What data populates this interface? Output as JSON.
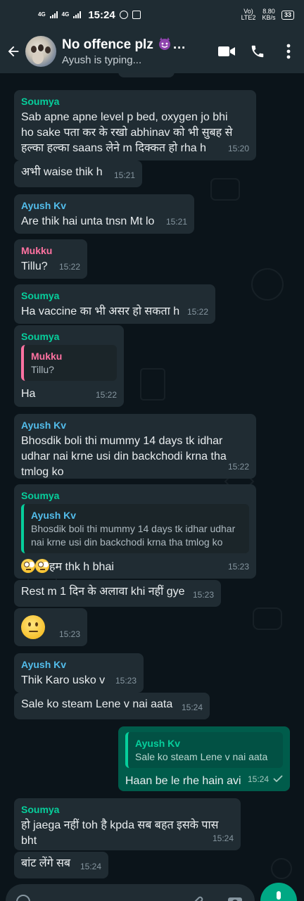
{
  "status_bar": {
    "net_left_1": "4G",
    "net_left_2": "4G",
    "time": "15:24",
    "volte": "Vo) LTE2",
    "speed": "8.80 KB/s",
    "battery": "33"
  },
  "header": {
    "title": "No offence plz",
    "subtitle": "Ayush is typing..."
  },
  "messages": [
    {
      "sender": "Soumya",
      "text": "Sab apne apne level p bed, oxygen jo bhi ho sake पता कर के रखो abhinav को भी सुबह से हल्का हल्का saans लेने m दिक्कत हो rha h",
      "time": "15:20"
    },
    {
      "sender": "",
      "text": "अभी waise thik h",
      "time": "15:21"
    },
    {
      "sender": "Ayush Kv",
      "text": "Are thik hai unta tnsn Mt lo",
      "time": "15:21"
    },
    {
      "sender": "Mukku",
      "text": "Tillu?",
      "time": "15:22"
    },
    {
      "sender": "Soumya",
      "text": "Ha vaccine का भी असर हो सकता h",
      "time": "15:22"
    },
    {
      "sender": "Soumya",
      "quote_name": "Mukku",
      "quote_text": "Tillu?",
      "text": "Ha",
      "time": "15:22"
    },
    {
      "sender": "Ayush Kv",
      "text": "Bhosdik boli thi mummy 14 days tk idhar udhar nai krne usi din backchodi krna tha tmlog ko",
      "time": "15:22"
    },
    {
      "sender": "Soumya",
      "quote_name": "Ayush Kv",
      "quote_text": "Bhosdik boli thi mummy 14 days tk idhar udhar nai krne usi din backchodi krna tha tmlog ko",
      "text": "हम thk h bhai",
      "time": "15:23"
    },
    {
      "sender": "",
      "text": "Rest m 1 दिन के अलावा khi नहीं gye",
      "time": "15:23"
    },
    {
      "sender": "",
      "text": "",
      "time": "15:23"
    },
    {
      "sender": "Ayush Kv",
      "text": "Thik Karo usko v",
      "time": "15:23"
    },
    {
      "sender": "",
      "text": "Sale ko steam Lene v nai aata",
      "time": "15:24"
    },
    {
      "sender": "",
      "quote_name": "Ayush Kv",
      "quote_text": "Sale ko steam Lene v nai aata",
      "text": "Haan be le rhe hain avi",
      "time": "15:24"
    },
    {
      "sender": "Soumya",
      "text": "हो jaega नहीं toh है kpda सब बहत इसके पास bht",
      "time": "15:24"
    },
    {
      "sender": "",
      "text": "बांट लेंगे सब",
      "time": "15:24"
    }
  ],
  "colors": {
    "header_bg": "#1f2c33",
    "chat_bg": "#0b141a",
    "in_bubble": "#202c33",
    "out_bubble": "#005c4b",
    "accent": "#00a884"
  },
  "icons": [
    "back-arrow-icon",
    "video-call-icon",
    "voice-call-icon",
    "more-options-icon",
    "mic-icon",
    "emoji-icon",
    "attach-icon",
    "camera-icon",
    "read-receipt-icon"
  ]
}
